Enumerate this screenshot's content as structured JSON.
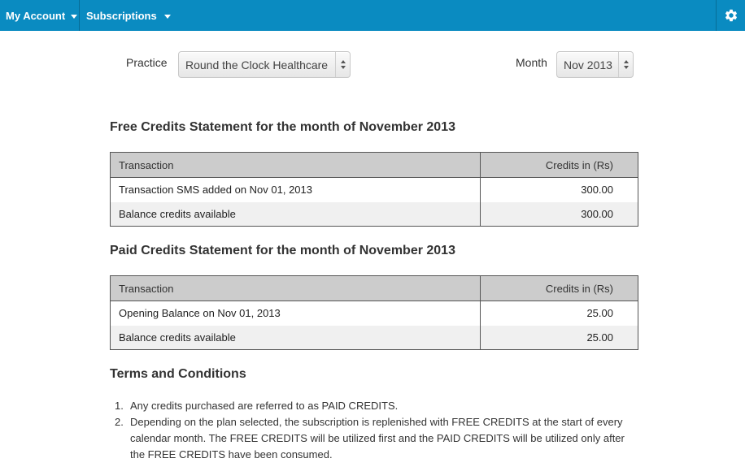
{
  "navbar": {
    "my_account": "My Account",
    "subscriptions": "Subscriptions",
    "settings_icon": "gear-icon",
    "bg_color": "#0a8bc1"
  },
  "filters": {
    "practice_label": "Practice",
    "practice_value": "Round the Clock Healthcare",
    "month_label": "Month",
    "month_value": "Nov 2013"
  },
  "free_statement": {
    "title": "Free Credits Statement for the month of November 2013",
    "headers": [
      "Transaction",
      "Credits in (Rs)"
    ],
    "rows": [
      {
        "transaction": "Transaction SMS added on Nov 01, 2013",
        "credits": "300.00"
      },
      {
        "transaction": "Balance credits available",
        "credits": "300.00"
      }
    ]
  },
  "paid_statement": {
    "title": "Paid Credits Statement for the month of November 2013",
    "headers": [
      "Transaction",
      "Credits in (Rs)"
    ],
    "rows": [
      {
        "transaction": "Opening Balance on Nov 01, 2013",
        "credits": "25.00"
      },
      {
        "transaction": "Balance credits available",
        "credits": "25.00"
      }
    ]
  },
  "terms": {
    "title": "Terms and Conditions",
    "items": [
      {
        "num": "1.",
        "text": "Any credits purchased are referred to as PAID CREDITS."
      },
      {
        "num": "2.",
        "text": "Depending on the plan selected, the subscription is replenished with FREE CREDITS at the start of every calendar month. The FREE CREDITS will be utilized first and the PAID CREDITS will be utilized only after the FREE CREDITS have been consumed."
      }
    ]
  }
}
